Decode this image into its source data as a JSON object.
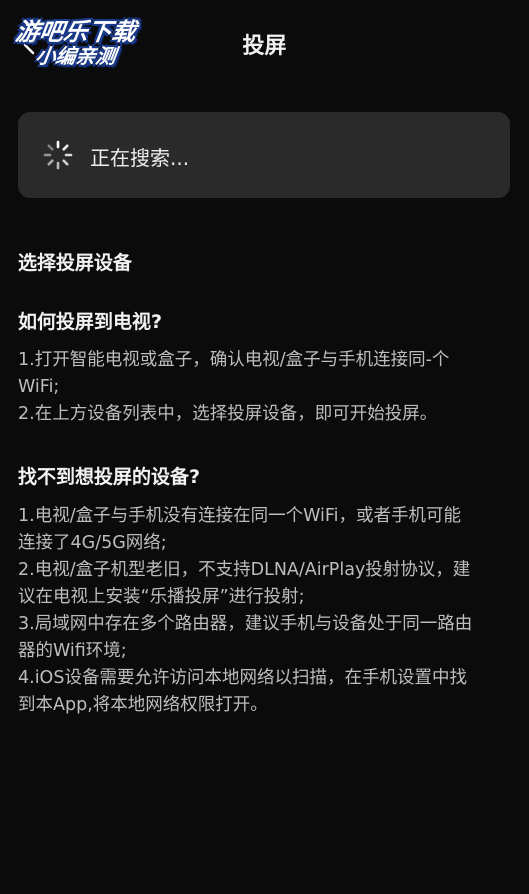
{
  "watermark": {
    "line1": "游吧乐下载",
    "line2": "小编亲测"
  },
  "header": {
    "title": "投屏",
    "back_icon": "chevron-left-icon"
  },
  "search": {
    "status": "正在搜索...",
    "spinner_icon": "loading-spinner-icon"
  },
  "select_heading": "选择投屏设备",
  "howto": {
    "title": "如何投屏到电视?",
    "lines": [
      "1.打开智能电视或盒子，确认电视/盒子与手机连接同-个",
      "WiFi;",
      "2.在上方设备列表中，选择投屏设备，即可开始投屏。"
    ]
  },
  "notfound": {
    "title": "找不到想投屏的设备?",
    "lines": [
      "1.电视/盒子与手机没有连接在同一个WiFi，或者手机可能",
      "连接了4G/5G网络;",
      "2.电视/盒子机型老旧，不支持DLNA/AirPlay投射协议，建",
      "议在电视上安装“乐播投屏”进行投射;",
      "3.局域网中存在多个路由器，建议手机与设备处于同一路由",
      "器的Wifi环境;",
      "4.iOS设备需要允许访问本地网络以扫描，在手机设置中找",
      "到本App,将本地网络权限打开。"
    ]
  },
  "colors": {
    "background": "#0b0b0b",
    "card": "#2a2a2a",
    "title_text": "#f2f2f2",
    "body_text": "#bdbdbd"
  }
}
